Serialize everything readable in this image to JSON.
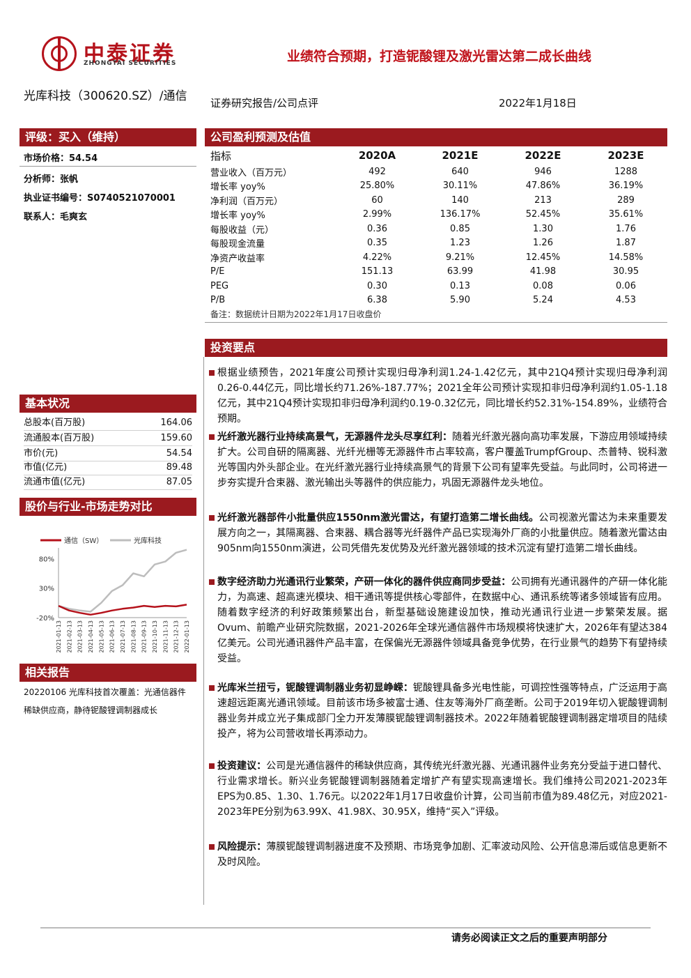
{
  "brand": {
    "cn": "中泰证券",
    "en": "ZHONGTAI SECURITIES"
  },
  "headline": "业绩符合预期，打造铌酸锂及激光雷达第二成长曲线",
  "stock_title": "光库科技（300620.SZ）/通信",
  "report_type": "证券研究报告/公司点评",
  "report_date": "2022年1月18日",
  "left": {
    "rating": "评级：买入（维持）",
    "market_price": "市场价格：54.54",
    "analyst": "分析师：张帆",
    "cert": "执业证书编号：S0740521070001",
    "contact": "联系人：毛爽玄",
    "basic_title": "基本状况",
    "basic": [
      {
        "label": "总股本(百万股)",
        "value": "164.06"
      },
      {
        "label": "流通股本(百万股)",
        "value": "159.60"
      },
      {
        "label": "市价(元)",
        "value": "54.54"
      },
      {
        "label": "市值(亿元)",
        "value": "89.48"
      },
      {
        "label": "流通市值(亿元)",
        "value": "87.05"
      }
    ],
    "chart_title": "股价与行业-市场走势对比",
    "related_title": "相关报告",
    "related_text": "20220106 光库科技首次覆盖：光通信器件稀缺供应商，静待铌酸锂调制器成长"
  },
  "chart_data": {
    "type": "line",
    "x": [
      "2021-01-13",
      "2021-02-13",
      "2021-03-13",
      "2021-04-13",
      "2021-05-13",
      "2021-06-13",
      "2021-07-13",
      "2021-08-13",
      "2021-09-13",
      "2021-10-13",
      "2021-11-13",
      "2021-12-13",
      "2022-01-13"
    ],
    "ylim": [
      -20,
      110
    ],
    "yticks": [
      "80%",
      "30%",
      "-20%"
    ],
    "ytick_values": [
      80,
      30,
      -20
    ],
    "series": [
      {
        "name": "通信（SW）",
        "color": "#b5121b",
        "values": [
          0,
          -8,
          -12,
          -15,
          -12,
          -8,
          -5,
          -3,
          0,
          -2,
          0,
          -1,
          2
        ]
      },
      {
        "name": "光库科技",
        "color": "#bdbdbd",
        "values": [
          0,
          -5,
          -8,
          -10,
          5,
          25,
          35,
          55,
          50,
          70,
          75,
          90,
          95
        ]
      }
    ]
  },
  "forecast": {
    "title": "公司盈利预测及估值",
    "header": [
      "指标",
      "2020A",
      "2021E",
      "2022E",
      "2023E"
    ],
    "rows": [
      [
        "营业收入（百万元）",
        "492",
        "640",
        "946",
        "1288"
      ],
      [
        "增长率 yoy%",
        "25.80%",
        "30.11%",
        "47.86%",
        "36.19%"
      ],
      [
        "净利润（百万元）",
        "60",
        "140",
        "213",
        "289"
      ],
      [
        "增长率 yoy%",
        "2.99%",
        "136.17%",
        "52.45%",
        "35.61%"
      ],
      [
        "每股收益（元）",
        "0.36",
        "0.85",
        "1.30",
        "1.76"
      ],
      [
        "每股现金流量",
        "0.35",
        "1.23",
        "1.26",
        "1.87"
      ],
      [
        "净资产收益率",
        "4.22%",
        "9.21%",
        "12.45%",
        "14.58%"
      ],
      [
        "P/E",
        "151.13",
        "63.99",
        "41.98",
        "30.95"
      ],
      [
        "PEG",
        "0.30",
        "0.13",
        "0.08",
        "0.06"
      ],
      [
        "P/B",
        "6.38",
        "5.90",
        "5.24",
        "4.53"
      ]
    ],
    "note": "备注：数据统计日期为2022年1月17日收盘价"
  },
  "invest": {
    "title": "投资要点",
    "points": [
      {
        "bold": "",
        "text": "根据业绩预告，2021年度公司预计实现归母净利润1.24-1.42亿元，其中21Q4预计实现归母净利润0.26-0.44亿元，同比增长约71.26%-187.77%；2021全年公司预计实现扣非归母净利润约1.05-1.18亿元，其中21Q4预计实现扣非归母净利润约0.19-0.32亿元，同比增长约52.31%-154.89%，业绩符合预期。"
      },
      {
        "bold": "光纤激光器行业持续高景气，无源器件龙头尽享红利：",
        "text": "随着光纤激光器向高功率发展，下游应用领域持续扩大。公司自研的隔离器、光纤光栅等无源器件市占率较高，客户覆盖TrumpfGroup、杰普特、锐科激光等国内外头部企业。在光纤激光器行业持续高景气的背景下公司有望率先受益。与此同时，公司将进一步夯实提升合束器、激光输出头等器件的供应能力，巩固无源器件龙头地位。"
      },
      {
        "bold": "光纤激光器部件小批量供应1550nm激光雷达，有望打造第二增长曲线。",
        "text": "公司视激光雷达为未来重要发展方向之一，其隔离器、合束器、耦合器等光纤器件产品已实现海外厂商的小批量供应。随着激光雷达由905nm向1550nm演进，公司凭借先发优势及光纤激光器领域的技术沉淀有望打造第二增长曲线。"
      },
      {
        "bold": "数字经济助力光通讯行业繁荣，产研一体化的器件供应商同步受益：",
        "text": "公司拥有光通讯器件的产研一体化能力，为高速、超高速光模块、相干通讯等提供核心零部件，在数据中心、通讯系统等诸多领域皆有应用。随着数字经济的利好政策频繁出台，新型基础设施建设加快，推动光通讯行业进一步繁荣发展。据Ovum、前瞻产业研究院数据，2021-2026年全球光通信器件市场规模将快速扩大，2026年有望达384亿美元。公司光通讯器件产品丰富，在保偏光无源器件领域具备竞争优势，在行业景气的趋势下有望持续受益。"
      },
      {
        "bold": "光库米兰扭亏，铌酸锂调制器业务初显峥嵘：",
        "text": "铌酸锂具备多光电性能，可调控性强等特点，广泛运用于高速超远距离光通讯领域。目前该市场多被富士通、住友等海外厂商垄断。公司于2019年切入铌酸锂调制器业务并成立光子集成部门全力开发薄膜铌酸锂调制器技术。2022年随着铌酸锂调制器定增项目的陆续投产，将为公司营收增长再添动力。"
      },
      {
        "bold": "投资建议：",
        "text": "公司是光通信器件的稀缺供应商，其传统光纤激光器、光通讯器件业务充分受益于进口替代、行业需求增长。新兴业务铌酸锂调制器随着定增扩产有望实现高速增长。我们维持公司2021-2023年EPS为0.85、1.30、1.76元。以2022年1月17日收盘价计算，公司当前市值为89.48亿元，对应2021-2023年PE分别为63.99X、41.98X、30.95X，维持“买入”评级。"
      },
      {
        "bold": "风险提示：",
        "text": "薄膜铌酸锂调制器进度不及预期、市场竞争加剧、汇率波动风险、公开信息滞后或信息更新不及时风险。"
      }
    ]
  },
  "footer": "请务必阅读正文之后的重要声明部分"
}
